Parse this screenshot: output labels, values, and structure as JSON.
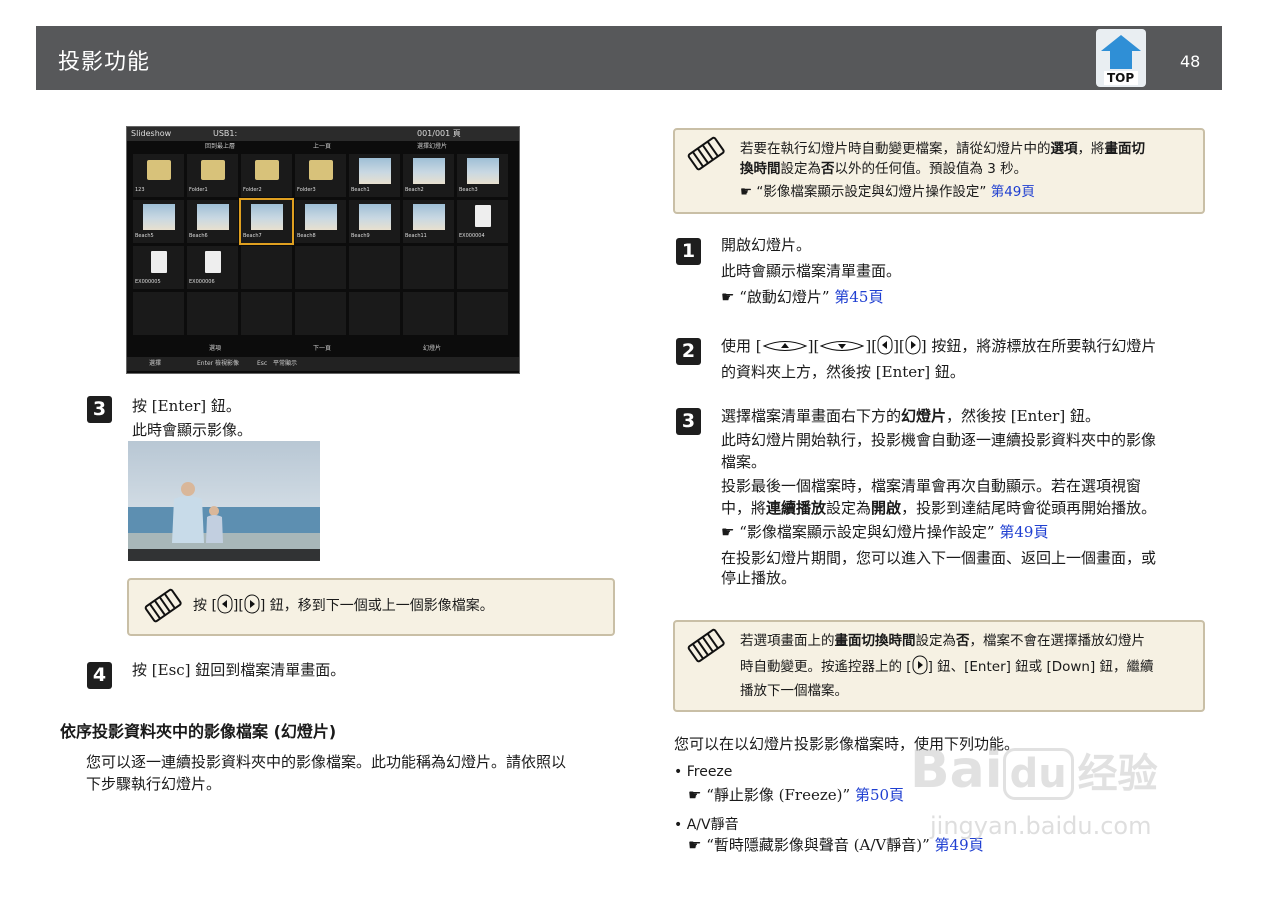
{
  "header": {
    "title": "投影功能",
    "page": "48",
    "top_label": "TOP"
  },
  "slideshow_ui": {
    "title": "Slideshow",
    "usb": "USB1:",
    "page": "001/001 頁",
    "top_folder": "回到最上層",
    "up_page": "上一頁",
    "down_page": "下一頁",
    "option": "選擇幻燈片",
    "select": "選項",
    "slideshow_btn": "幻燈片",
    "footer_select": "選擇",
    "footer_enter": "Enter",
    "footer_enter_text": "檢視影像",
    "footer_esc": "Esc",
    "footer_esc_text": "平常顯示",
    "items": [
      "123",
      "Folder1",
      "Folder2",
      "Folder3",
      "Beach1",
      "Beach2",
      "Beach3",
      "Beach5",
      "Beach6",
      "Beach7",
      "Beach8",
      "Beach9",
      "Beach11",
      "EX000004",
      "EX000005",
      "EX000006"
    ]
  },
  "left": {
    "step3": {
      "num": "3",
      "line1": "按 [Enter] 鈕。",
      "line2": "此時會顯示影像。"
    },
    "note1": {
      "pre": "按 [",
      "post": "] 鈕，移到下一個或上一個影像檔案。"
    },
    "step4": {
      "num": "4",
      "line1": "按 [Esc] 鈕回到檔案清單畫面。"
    },
    "section_title": "依序投影資料夾中的影像檔案 (幻燈片)",
    "para1": "您可以逐一連續投影資料夾中的影像檔案。此功能稱為幻燈片。請依照以",
    "para2": "下步驟執行幻燈片。"
  },
  "right": {
    "note_top": {
      "l1a": "若要在執行幻燈片時自動變更檔案，請從幻燈片中的",
      "l1b": "選項",
      "l1c": "，將",
      "l1d": "畫面切",
      "l2a": "換時間",
      "l2b": "設定為",
      "l2c": "否",
      "l2d": "以外的任何值。預設值為 3 秒。",
      "ref_text": "“影像檔案顯示設定與幻燈片操作設定”",
      "ref_page": "第49頁"
    },
    "step1": {
      "num": "1",
      "l1": "開啟幻燈片。",
      "l2": "此時會顯示檔案清單畫面。",
      "ref_text": "“啟動幻燈片”",
      "ref_page": "第45頁"
    },
    "step2": {
      "num": "2",
      "l1a": "使用 [",
      "l1b": "] 按鈕，將游標放在所要執行幻燈片",
      "l2": "的資料夾上方，然後按 [Enter] 鈕。"
    },
    "step3": {
      "num": "3",
      "l1a": "選擇檔案清單畫面右下方的",
      "l1b": "幻燈片",
      "l1c": "，然後按 [Enter] 鈕。",
      "l2": "此時幻燈片開始執行，投影機會自動逐一連續投影資料夾中的影像",
      "l3": "檔案。",
      "l4": "投影最後一個檔案時，檔案清單會再次自動顯示。若在選項視窗",
      "l5a": "中，將",
      "l5b": "連續播放",
      "l5c": "設定為",
      "l5d": "開啟",
      "l5e": "，投影到達結尾時會從頭再開始播放。",
      "ref_text": "“影像檔案顯示設定與幻燈片操作設定”",
      "ref_page": "第49頁",
      "l6": "在投影幻燈片期間，您可以進入下一個畫面、返回上一個畫面，或",
      "l7": "停止播放。"
    },
    "note_bottom": {
      "l1a": "若選項畫面上的",
      "l1b": "畫面切換時間",
      "l1c": "設定為",
      "l1d": "否",
      "l1e": "，檔案不會在選擇播放幻燈片",
      "l2a": "時自動變更。按遙控器上的 [",
      "l2b": "] 鈕、[Enter] 鈕或 [Down] 鈕，繼續",
      "l3": "播放下一個檔案。"
    },
    "intro": "您可以在以幻燈片投影影像檔案時，使用下列功能。",
    "freeze": {
      "label": "Freeze",
      "ref_text": "“靜止影像 (Freeze)”",
      "ref_page": "第50頁"
    },
    "av": {
      "label": "A/V靜音",
      "ref_text": "“暫時隱藏影像與聲音 (A/V靜音)”",
      "ref_page": "第49頁"
    }
  },
  "watermark": {
    "brand": "Bai",
    "du": "du",
    "jingyan": "经验",
    "url": "jingyan.baidu.com"
  }
}
